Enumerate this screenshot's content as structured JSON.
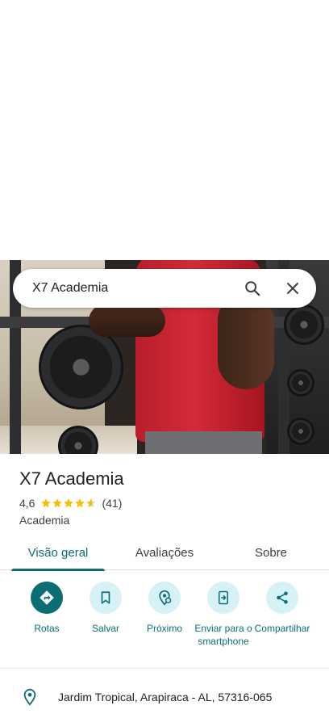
{
  "search": {
    "query": "X7 Academia"
  },
  "place": {
    "name": "X7 Academia",
    "rating": "4,6",
    "rating_value": 4.6,
    "review_count": "(41)",
    "category": "Academia"
  },
  "tabs": [
    {
      "label": "Visão geral",
      "active": true
    },
    {
      "label": "Avaliações",
      "active": false
    },
    {
      "label": "Sobre",
      "active": false
    }
  ],
  "actions": [
    {
      "label": "Rotas",
      "icon": "directions-icon"
    },
    {
      "label": "Salvar",
      "icon": "bookmark-icon"
    },
    {
      "label": "Próximo",
      "icon": "nearby-icon"
    },
    {
      "label": "Enviar para o smartphone",
      "icon": "send-to-phone-icon"
    },
    {
      "label": "Compartilhar",
      "icon": "share-icon"
    }
  ],
  "info": {
    "address": "Jardim Tropical, Arapiraca - AL, 57316-065"
  },
  "colors": {
    "accent": "#0b6e74",
    "accent_light": "#d7f2f6",
    "star": "#fbbc04"
  }
}
